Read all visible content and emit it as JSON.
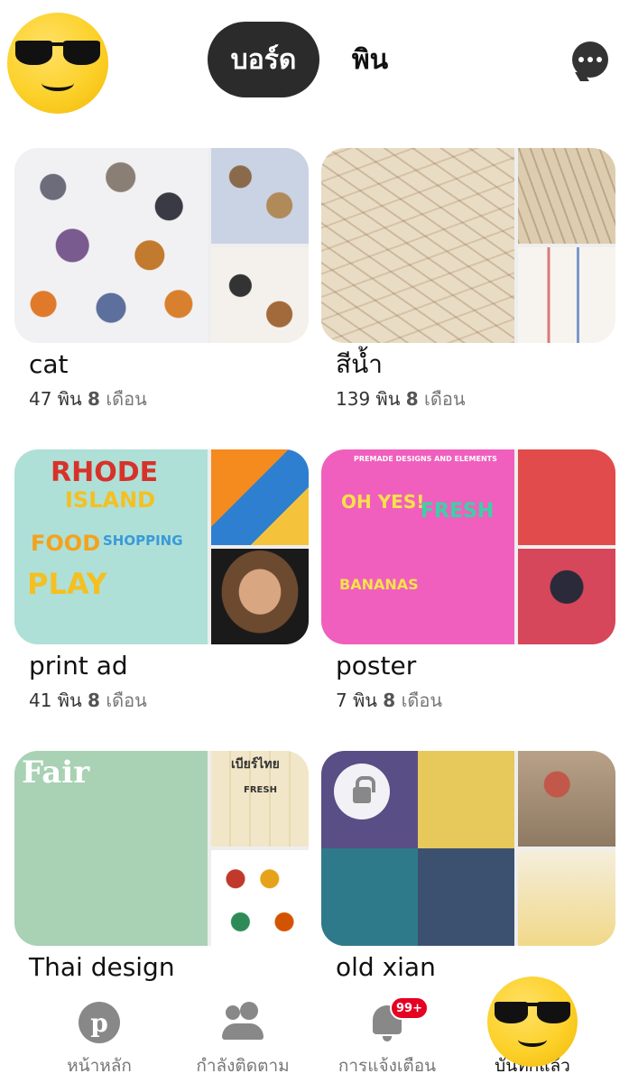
{
  "header": {
    "tab_active": "บอร์ด",
    "tab_inactive": "พิน"
  },
  "boards": [
    {
      "title": "cat",
      "pin_count": "47 พิน",
      "age_num": "8",
      "age_unit": "เดือน"
    },
    {
      "title": "สีน้ำ",
      "pin_count": "139 พิน",
      "age_num": "8",
      "age_unit": "เดือน"
    },
    {
      "title": "print ad",
      "pin_count": "41 พิน",
      "age_num": "8",
      "age_unit": "เดือน"
    },
    {
      "title": "poster",
      "pin_count": "7 พิน",
      "age_num": "8",
      "age_unit": "เดือน"
    },
    {
      "title": "Thai design",
      "secret": false
    },
    {
      "title": "old xian",
      "secret": true
    }
  ],
  "covers": {
    "print": {
      "w1": "RHODE",
      "w2": "ISLAND",
      "w3": "FOOD",
      "w4": "SHOPPING",
      "w5": "PLAY"
    },
    "poster": {
      "w1": "PREMADE DESIGNS AND ELEMENTS",
      "w2": "OH YES!",
      "w3": "FRESH",
      "w4": "BANANAS"
    },
    "thai": {
      "w1": "Fair",
      "w2": "เบียร์ไทย",
      "w3": "FRESH"
    }
  },
  "bottom_nav": {
    "items": [
      {
        "label": "หน้าหลัก",
        "icon": "pinterest-icon"
      },
      {
        "label": "กำลังติดตาม",
        "icon": "following-icon"
      },
      {
        "label": "การแจ้งเตือน",
        "icon": "bell-icon",
        "badge": "99+"
      },
      {
        "label": "บันทึกแล้ว",
        "icon": "profile-icon"
      }
    ]
  },
  "colors": {
    "accent_red": "#e60023",
    "active_tab_bg": "#2b2b2b",
    "muted_text": "#777777"
  }
}
